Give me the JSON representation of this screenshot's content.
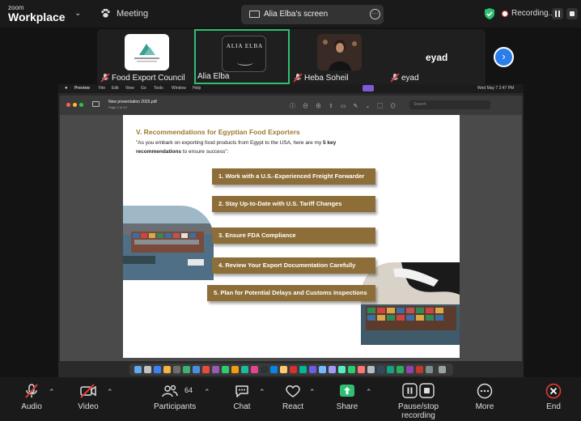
{
  "app": {
    "brand_small": "zoom",
    "brand_large": "Workplace"
  },
  "header": {
    "meeting_label": "Meeting",
    "screen_share_label": "Alia Elba's screen",
    "recording_label": "Recording..."
  },
  "gallery": {
    "participants": [
      {
        "name": "Food Export Council",
        "muted": true
      },
      {
        "name": "Alia Elba",
        "muted": false,
        "active": true,
        "logo_text": "ALIA ELBA"
      },
      {
        "name": "Heba Soheil",
        "muted": true
      },
      {
        "name": "eyad",
        "muted": true
      }
    ],
    "overflow_name": "eyad"
  },
  "mac": {
    "menu": [
      "Preview",
      "File",
      "Edit",
      "View",
      "Go",
      "Tools",
      "Window",
      "Help"
    ],
    "clock": "Wed May 7  2:47 PM"
  },
  "preview": {
    "doc_name": "New presentation 2025.pdf",
    "doc_sub": "Page 2 of 10",
    "search_placeholder": "Search"
  },
  "slide": {
    "title": "V. Recommendations for Egyptian Food Exporters",
    "intro_a": "\"As you embark on exporting food products from Egypt to the USA, here are my ",
    "intro_bold1": "5 key",
    "intro_b": "recommendations",
    "intro_c": " to ensure success\":",
    "items": [
      "1. Work with a U.S.-Experienced Freight Forwarder",
      "2. Stay Up-to-Date with U.S. Tariff Changes",
      "3. Ensure FDA Compliance",
      "4. Review Your Export Documentation Carefully",
      "5. Plan for Potential Delays and Customs Inspections"
    ]
  },
  "toolbar": {
    "audio": "Audio",
    "video": "Video",
    "participants": "Participants",
    "participant_count": "64",
    "chat": "Chat",
    "react": "React",
    "share": "Share",
    "pause_stop": "Pause/stop recording",
    "more": "More",
    "end": "End"
  },
  "colors": {
    "accent_green": "#2fbf71",
    "slide_gold": "#8d6e38",
    "slide_title": "#9b7a2e",
    "end_red": "#e53935",
    "next_blue": "#2b7de9"
  }
}
